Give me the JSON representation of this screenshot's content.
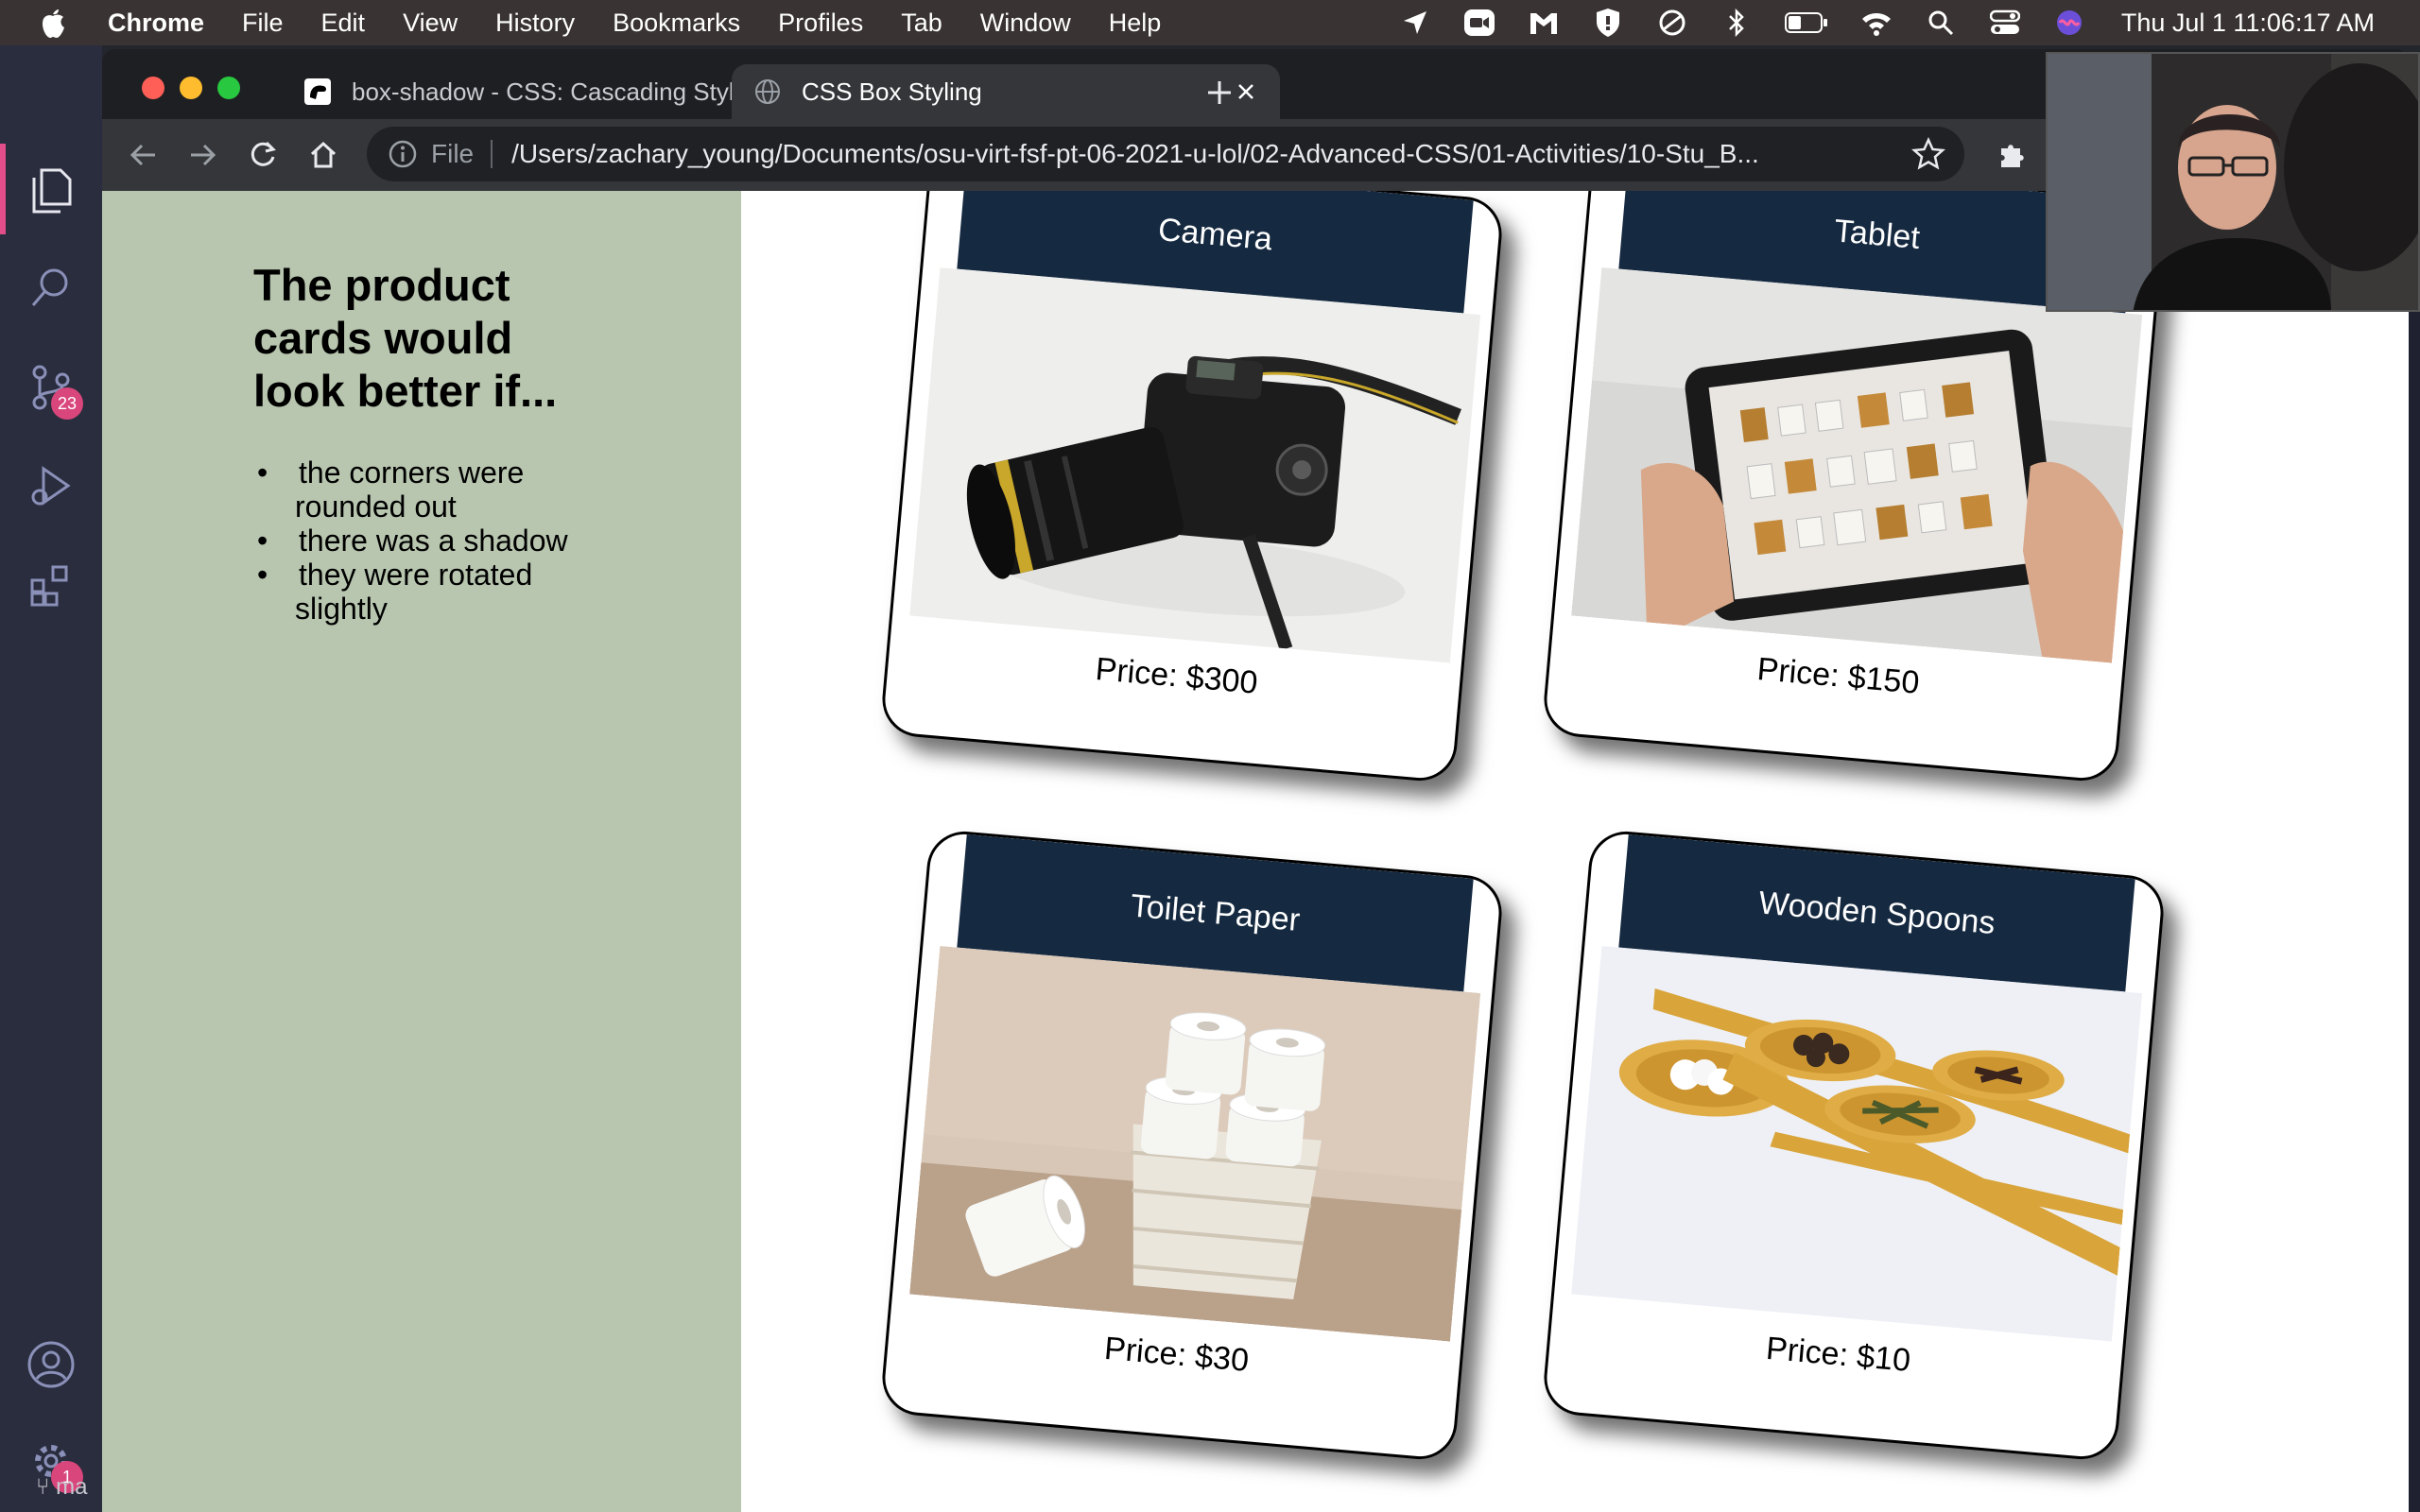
{
  "menubar": {
    "app_name": "Chrome",
    "menus": [
      "File",
      "Edit",
      "View",
      "History",
      "Bookmarks",
      "Profiles",
      "Tab",
      "Window",
      "Help"
    ],
    "clock": "Thu Jul 1  11:06:17 AM"
  },
  "vscode": {
    "source_control_badge": "23",
    "settings_badge": "1",
    "branch": "ma"
  },
  "chrome": {
    "tabs": [
      {
        "title": "box-shadow - CSS: Cascading Style Sheets"
      },
      {
        "title": "CSS Box Styling"
      }
    ],
    "omnibox": {
      "scheme": "File",
      "url": "/Users/zachary_young/Documents/osu-virt-fsf-pt-06-2021-u-lol/02-Advanced-CSS/01-Activities/10-Stu_B..."
    }
  },
  "page": {
    "heading": "The product cards would look better if...",
    "bullets": [
      "the corners were rounded out",
      "there was a shadow",
      "they were rotated slightly"
    ],
    "cards": [
      {
        "title": "Camera",
        "price": "Price: $300",
        "image": "camera-photo"
      },
      {
        "title": "Tablet",
        "price": "Price: $150",
        "image": "tablet-photo"
      },
      {
        "title": "Toilet Paper",
        "price": "Price: $30",
        "image": "toilet-paper-photo"
      },
      {
        "title": "Wooden Spoons",
        "price": "Price: $10",
        "image": "wooden-spoons-photo"
      }
    ]
  },
  "colors": {
    "sidebar": "#b8c6af",
    "card_header": "#152940",
    "chrome_toolbar": "#35363a",
    "menubar": "#3a3333"
  }
}
